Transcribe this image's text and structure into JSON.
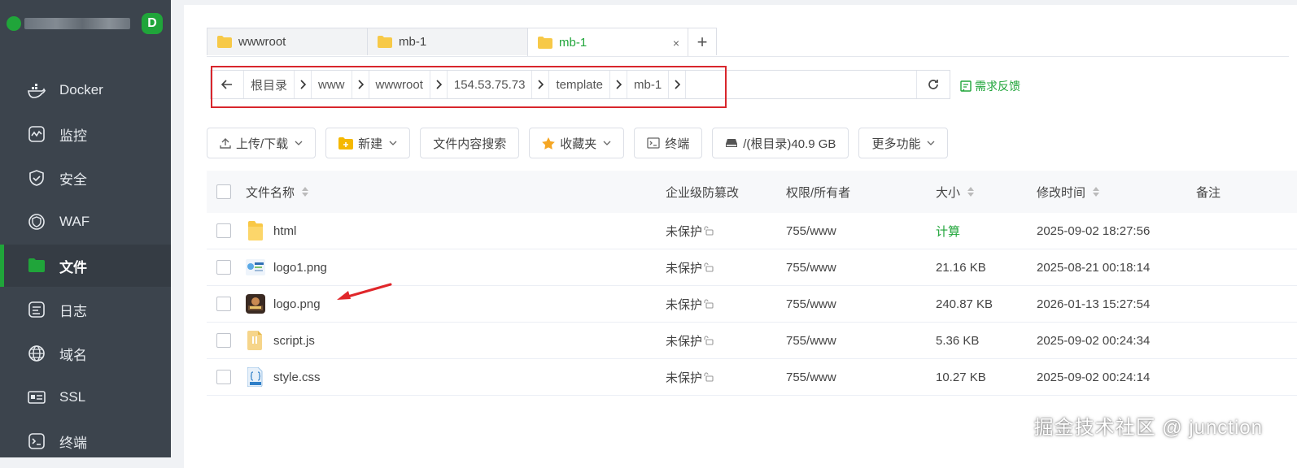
{
  "sidebar": {
    "items": [
      {
        "label": "Docker",
        "icon": "docker-icon"
      },
      {
        "label": "监控",
        "icon": "monitor-icon"
      },
      {
        "label": "安全",
        "icon": "shield-icon"
      },
      {
        "label": "WAF",
        "icon": "waf-icon"
      },
      {
        "label": "文件",
        "icon": "folder-icon",
        "active": true
      },
      {
        "label": "日志",
        "icon": "log-icon"
      },
      {
        "label": "域名",
        "icon": "globe-icon"
      },
      {
        "label": "SSL",
        "icon": "ssl-icon"
      },
      {
        "label": "终端",
        "icon": "terminal-icon"
      }
    ],
    "logo_letter": "D"
  },
  "tabs": [
    {
      "label": "wwwroot",
      "active": false
    },
    {
      "label": "mb-1",
      "active": false
    },
    {
      "label": "mb-1",
      "active": true
    }
  ],
  "tab_close": "×",
  "tab_add": "+",
  "breadcrumb": [
    "根目录",
    "www",
    "wwwroot",
    "154.53.75.73",
    "template",
    "mb-1"
  ],
  "feedback_label": "需求反馈",
  "toolbar": {
    "upload": "上传/下载",
    "new": "新建",
    "search": "文件内容搜索",
    "favorites": "收藏夹",
    "terminal": "终端",
    "disk": "/(根目录)40.9 GB",
    "more": "更多功能"
  },
  "table": {
    "headers": {
      "name": "文件名称",
      "protect": "企业级防篡改",
      "perm": "权限/所有者",
      "size": "大小",
      "mtime": "修改时间",
      "note": "备注"
    },
    "rows": [
      {
        "name": "html",
        "icon": "folder-icon",
        "protect": "未保护",
        "perm": "755/www",
        "size": "计算",
        "mtime": "2025-09-02 18:27:56"
      },
      {
        "name": "logo1.png",
        "icon": "image-icon",
        "protect": "未保护",
        "perm": "755/www",
        "size": "21.16 KB",
        "mtime": "2025-08-21 00:18:14"
      },
      {
        "name": "logo.png",
        "icon": "image-icon",
        "protect": "未保护",
        "perm": "755/www",
        "size": "240.87 KB",
        "mtime": "2026-01-13 15:27:54"
      },
      {
        "name": "script.js",
        "icon": "js-file-icon",
        "protect": "未保护",
        "perm": "755/www",
        "size": "5.36 KB",
        "mtime": "2025-09-02 00:24:34"
      },
      {
        "name": "style.css",
        "icon": "css-file-icon",
        "protect": "未保护",
        "perm": "755/www",
        "size": "10.27 KB",
        "mtime": "2025-09-02 00:24:14"
      }
    ]
  },
  "watermark": "掘金技术社区 @ junction",
  "colors": {
    "accent": "#20a53a",
    "sidebar": "#3c444d",
    "highlight": "#d8262c",
    "arrow": "#e0262a"
  }
}
